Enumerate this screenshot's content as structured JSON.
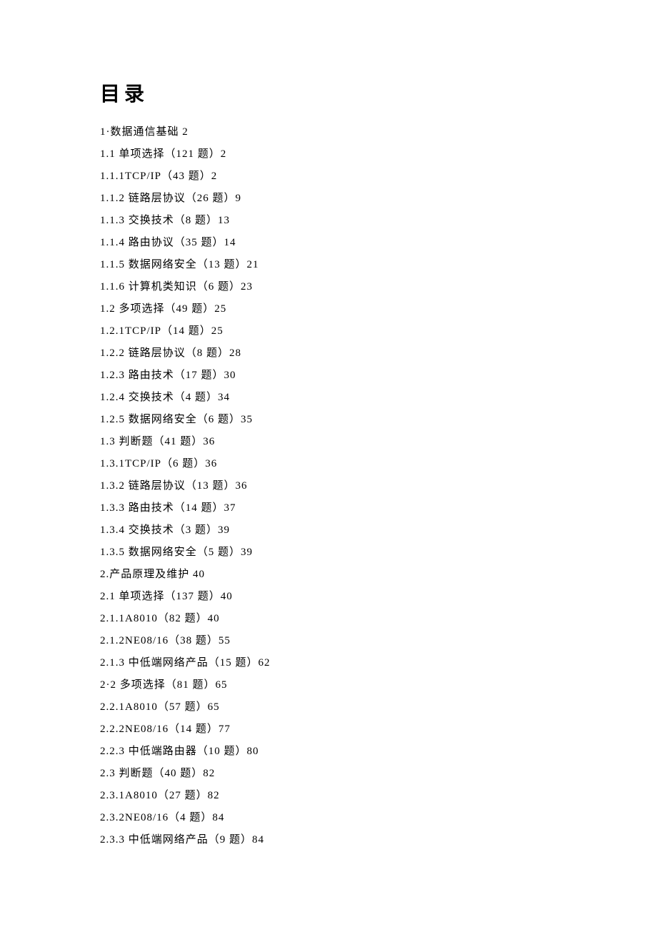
{
  "title": "目录",
  "toc": [
    {
      "text": "1·数据通信基础 2"
    },
    {
      "text": "1.1 单项选择（121 题）2"
    },
    {
      "text": "1.1.1TCP/IP（43 题）2"
    },
    {
      "text": "1.1.2 链路层协议（26 题）9"
    },
    {
      "text": "1.1.3 交换技术（8 题）13"
    },
    {
      "text": "1.1.4 路由协议（35 题）14"
    },
    {
      "text": "1.1.5 数据网络安全（13 题）21"
    },
    {
      "text": "1.1.6 计算机类知识（6 题）23"
    },
    {
      "text": "1.2 多项选择（49 题）25"
    },
    {
      "text": "1.2.1TCP/IP（14 题）25"
    },
    {
      "text": "1.2.2 链路层协议（8 题）28"
    },
    {
      "text": "1.2.3 路由技术（17 题）30"
    },
    {
      "text": "1.2.4 交换技术（4 题）34"
    },
    {
      "text": "1.2.5 数据网络安全（6 题）35"
    },
    {
      "text": "1.3 判断题（41 题）36"
    },
    {
      "text": "1.3.1TCP/IP（6 题）36"
    },
    {
      "text": "1.3.2 链路层协议（13 题）36"
    },
    {
      "text": "1.3.3 路由技术（14 题）37"
    },
    {
      "text": "1.3.4 交换技术（3 题）39"
    },
    {
      "text": "1.3.5 数据网络安全（5 题）39"
    },
    {
      "text": "2.产品原理及维护 40"
    },
    {
      "text": "2.1 单项选择（137 题）40"
    },
    {
      "text": "2.1.1A8010（82 题）40"
    },
    {
      "text": "2.1.2NE08/16（38 题）55"
    },
    {
      "text": "2.1.3 中低端网络产品（15 题）62"
    },
    {
      "text": "2·2 多项选择（81 题）65"
    },
    {
      "text": "2.2.1A8010（57 题）65"
    },
    {
      "text": "2.2.2NE08/16（14 题）77"
    },
    {
      "text": "2.2.3 中低端路由器（10 题）80"
    },
    {
      "text": "2.3 判断题（40 题）82"
    },
    {
      "text": "2.3.1A8010（27 题）82"
    },
    {
      "text": "2.3.2NE08/16（4 题）84"
    },
    {
      "text": "2.3.3 中低端网络产品（9 题）84"
    }
  ]
}
